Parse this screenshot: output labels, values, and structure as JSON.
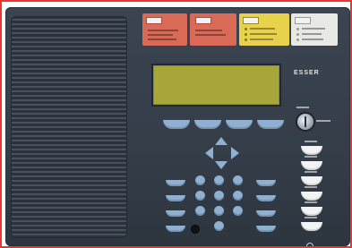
{
  "panel": {
    "brand_text": "ESSER",
    "colors": {
      "panel": "#343d48",
      "grille": "#2b323b",
      "lcd": "#a7a63b",
      "key_blue": "#8fb0d0",
      "label_red": "#d86a57",
      "label_yellow": "#e8d24c",
      "label_white": "#e8e8e4",
      "frame_red": "#e33"
    }
  }
}
